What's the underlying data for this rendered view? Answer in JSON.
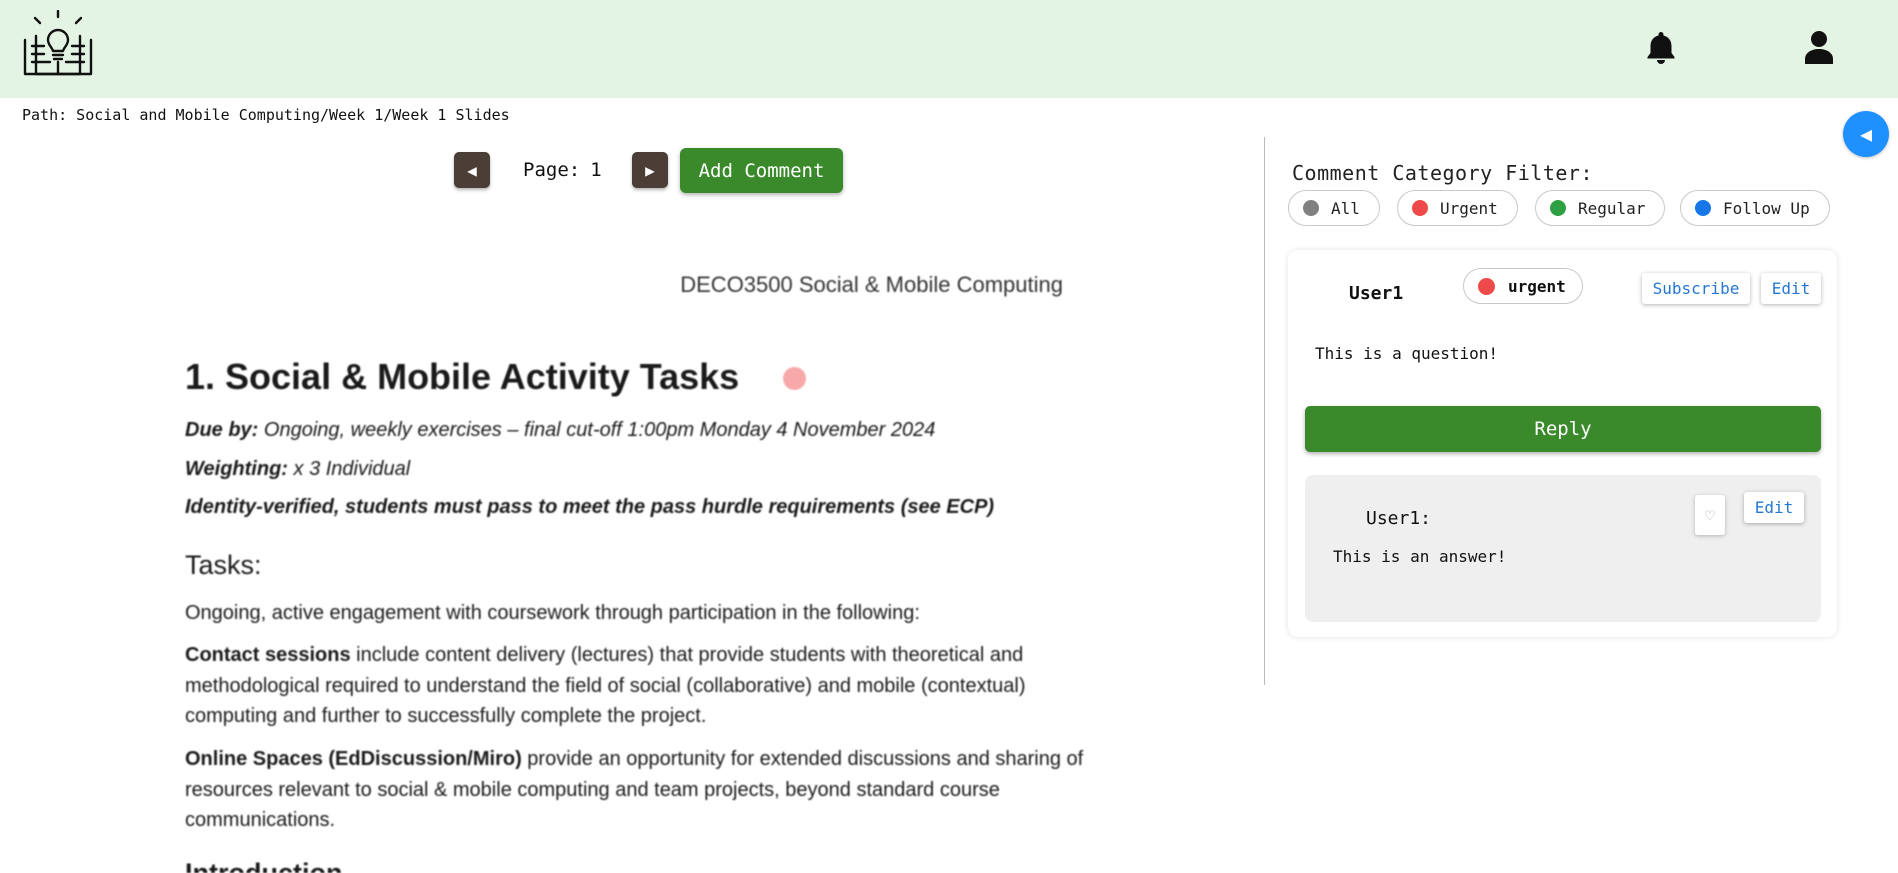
{
  "header": {
    "logo_icon": "lightbulb-book-icon",
    "notification_icon": "bell-icon",
    "profile_icon": "user-icon"
  },
  "path": "Path: Social and Mobile Computing/Week 1/Week 1 Slides",
  "sidebar_toggle": "◀",
  "viewer": {
    "prev_label": "◀",
    "next_label": "▶",
    "page_label": "Page:",
    "page_number": "1",
    "add_comment_label": "Add Comment"
  },
  "document": {
    "header": "DECO3500 Social & Mobile Computing",
    "title": "1. Social & Mobile Activity Tasks",
    "due_label": "Due by:",
    "due_value": " Ongoing, weekly exercises – final cut-off 1:00pm Monday 4 November 2024",
    "weighting_label": "Weighting:",
    "weighting_value": " x 3 Individual",
    "identity": "Identity-verified, students must pass to meet the pass hurdle requirements (see ECP)",
    "tasks_heading": "Tasks:",
    "intro": "Ongoing, active engagement with coursework through participation in the following:",
    "contact_label": "Contact sessions",
    "contact_text": " include content delivery (lectures) that provide students with theoretical and methodological required to understand the field of social (collaborative) and mobile (contextual) computing and further to successfully complete the project.",
    "online_label": "Online Spaces (EdDiscussion/Miro)",
    "online_text": " provide an opportunity for extended discussions and sharing of resources relevant to social & mobile computing and team projects, beyond standard course communications.",
    "next_heading": "Introduction"
  },
  "comments": {
    "filter_title": "Comment Category Filter:",
    "filters": [
      {
        "label": "All",
        "color": "#808080"
      },
      {
        "label": "Urgent",
        "color": "#ef4a4a"
      },
      {
        "label": "Regular",
        "color": "#2ea043"
      },
      {
        "label": "Follow Up",
        "color": "#1677e8"
      }
    ],
    "thread": {
      "user": "User1",
      "category": "urgent",
      "category_color": "#ef4a4a",
      "subscribe_label": "Subscribe",
      "edit_label": "Edit",
      "text": "This is a question!",
      "reply_label": "Reply",
      "answer": {
        "user": "User1:",
        "text": "This is an answer!",
        "like_icon": "heart-icon",
        "edit_label": "Edit"
      }
    }
  }
}
